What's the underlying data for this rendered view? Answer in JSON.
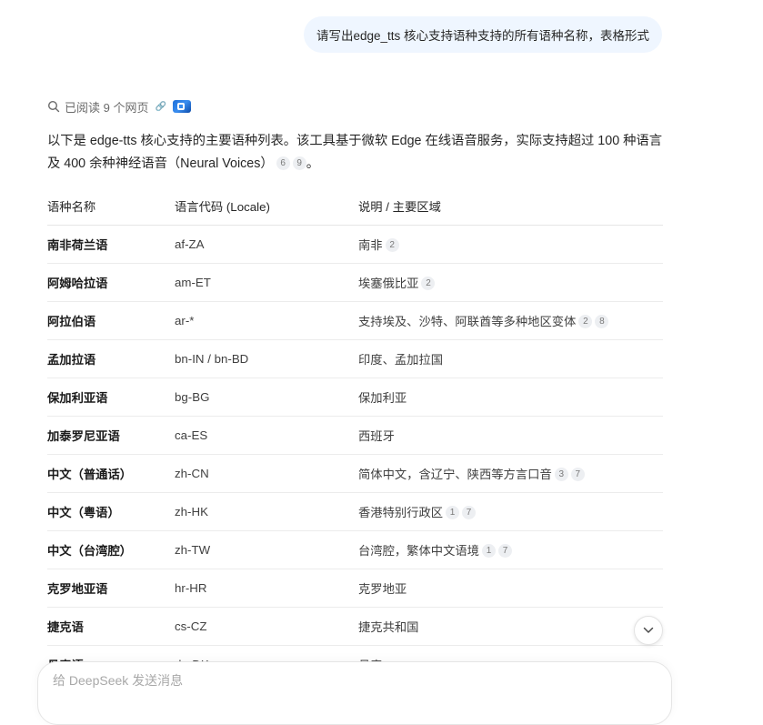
{
  "user_message": "请写出edge_tts 核心支持语种支持的所有语种名称，表格形式",
  "search": {
    "status": "已阅读 9 个网页",
    "icon": "search-icon"
  },
  "intro": {
    "part1": "以下是 edge-tts 核心支持的主要语种列表。该工具基于微软 Edge 在线语音服务，实际支持超过 100 种语言及 400 余种神经语音（Neural Voices）",
    "citations": [
      "6",
      "9"
    ],
    "end": "。"
  },
  "table": {
    "headers": [
      "语种名称",
      "语言代码 (Locale)",
      "说明 / 主要区域"
    ],
    "rows": [
      {
        "name": "南非荷兰语",
        "code": "af-ZA",
        "desc": "南非",
        "cites": [
          "2"
        ]
      },
      {
        "name": "阿姆哈拉语",
        "code": "am-ET",
        "desc": "埃塞俄比亚",
        "cites": [
          "2"
        ]
      },
      {
        "name": "阿拉伯语",
        "code": "ar-*",
        "desc": "支持埃及、沙特、阿联酋等多种地区变体",
        "cites": [
          "2",
          "8"
        ]
      },
      {
        "name": "孟加拉语",
        "code": "bn-IN / bn-BD",
        "desc": "印度、孟加拉国",
        "cites": []
      },
      {
        "name": "保加利亚语",
        "code": "bg-BG",
        "desc": "保加利亚",
        "cites": []
      },
      {
        "name": "加泰罗尼亚语",
        "code": "ca-ES",
        "desc": "西班牙",
        "cites": []
      },
      {
        "name": "中文（普通话）",
        "code": "zh-CN",
        "desc": "简体中文，含辽宁、陕西等方言口音",
        "cites": [
          "3",
          "7"
        ]
      },
      {
        "name": "中文（粤语）",
        "code": "zh-HK",
        "desc": "香港特别行政区",
        "cites": [
          "1",
          "7"
        ]
      },
      {
        "name": "中文（台湾腔）",
        "code": "zh-TW",
        "desc": "台湾腔，繁体中文语境",
        "cites": [
          "1",
          "7"
        ]
      },
      {
        "name": "克罗地亚语",
        "code": "hr-HR",
        "desc": "克罗地亚",
        "cites": []
      },
      {
        "name": "捷克语",
        "code": "cs-CZ",
        "desc": "捷克共和国",
        "cites": []
      },
      {
        "name": "丹麦语",
        "code": "da-DK",
        "desc": "丹麦",
        "cites": []
      }
    ]
  },
  "composer": {
    "placeholder": "给 DeepSeek 发送消息"
  },
  "colors": {
    "user_bubble": "#eff6ff",
    "citation_bg": "#edeff2"
  }
}
